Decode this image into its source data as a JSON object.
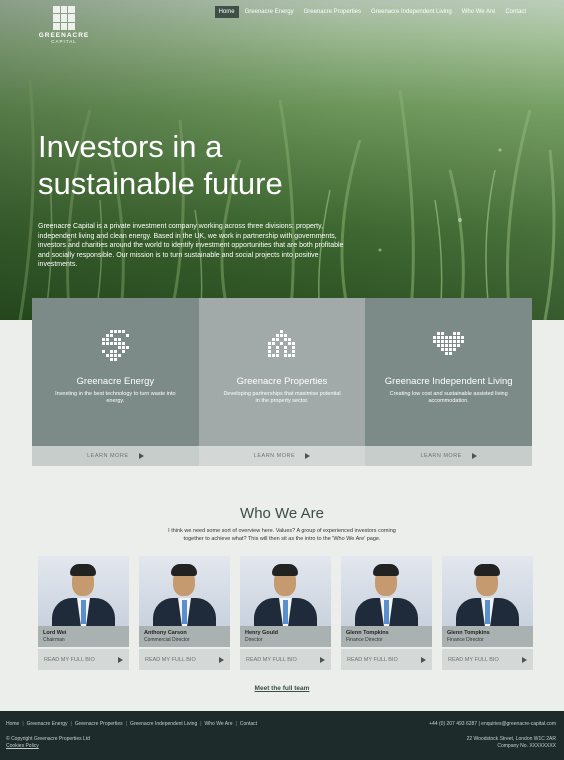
{
  "brand": {
    "name": "GREENACRE",
    "sub": "CAPITAL"
  },
  "nav": [
    "Home",
    "Greenacre Energy",
    "Greenacre Properties",
    "Greenacre Independent Living",
    "Who We Are",
    "Contact"
  ],
  "hero": {
    "title": "Investors in a sustainable future",
    "text": "Greenacre Capital is a private investment company working across three divisions: property, independent living and clean energy. Based in the UK, we work in partnership with governments, investors and charities around the world to identify investment opportunities that are both profitable and socially responsible. Our mission is to turn sustainable and social projects into positive investments."
  },
  "cards": [
    {
      "title": "Greenacre Energy",
      "desc": "Investing in the best technology to turn waste into energy.",
      "cta": "LEARN MORE",
      "icon": "energy-icon"
    },
    {
      "title": "Greenacre Properties",
      "desc": "Developing partnerships that maximise potential in the property sector.",
      "cta": "LEARN MORE",
      "icon": "house-icon"
    },
    {
      "title": "Greenacre Independent Living",
      "desc": "Creating low cost and sustainable assisted living accommodation.",
      "cta": "LEARN MORE",
      "icon": "heart-icon"
    }
  ],
  "who": {
    "title": "Who We Are",
    "intro": "I think we need some sort of overview here. Values? A group of experienced investors coming together to achieve what? This will then sit as the intro to the 'Who We Are' page."
  },
  "team": [
    {
      "name": "Lord Wei",
      "role": "Chairman",
      "cta": "READ MY FULL BIO"
    },
    {
      "name": "Anthony Carson",
      "role": "Commercial Director",
      "cta": "READ MY FULL BIO"
    },
    {
      "name": "Henry Gould",
      "role": "Director",
      "cta": "READ MY FULL BIO"
    },
    {
      "name": "Glenn Tompkins",
      "role": "Finance Director",
      "cta": "READ MY FULL BIO"
    },
    {
      "name": "Glenn Tompkins",
      "role": "Finance Director",
      "cta": "READ MY FULL BIO"
    }
  ],
  "meet": "Meet the full team",
  "footer": {
    "copyright": "© Copyright Greenacre Properties Ltd",
    "cookies": "Cookies Policy",
    "contact": "+44 (0) 207 493 6287  |  enquiries@greenacre-capital.com",
    "address1": "22 Woodstock Street, London W1C 2AR",
    "address2": "Company No. XXXXXXXX"
  },
  "colors": {
    "accent": "#3b4e49",
    "footer": "#1d2c2b",
    "card_dark": "#7d8b88",
    "card_light": "#a1aaa8"
  }
}
